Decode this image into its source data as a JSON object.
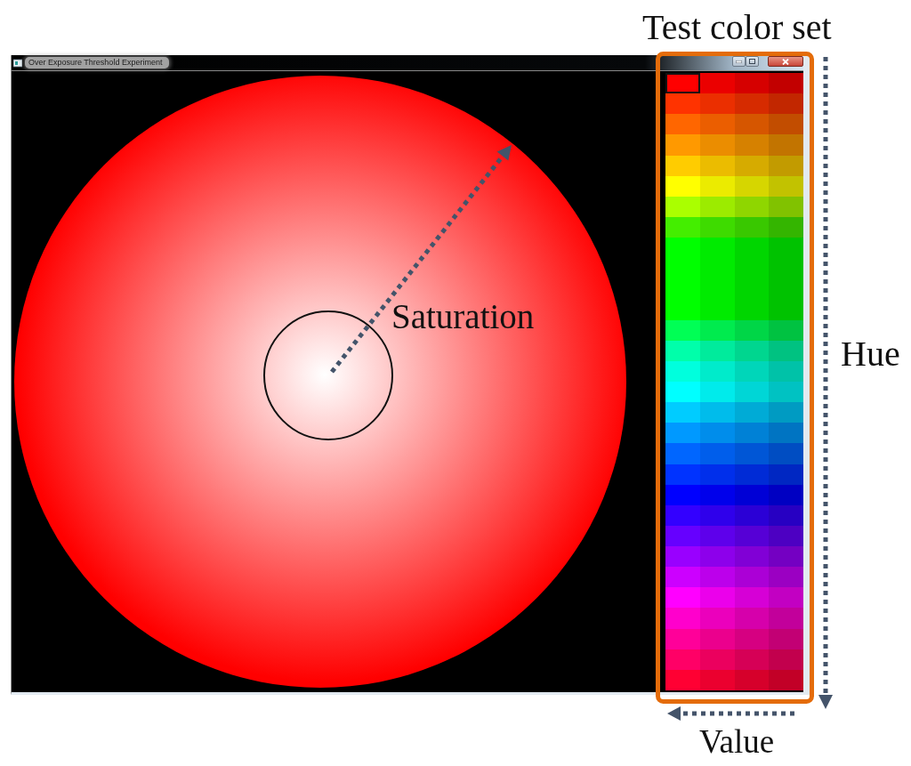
{
  "annotations": {
    "heading": "Test color set",
    "saturation_label": "Saturation",
    "hue_label": "Hue",
    "value_label": "Value"
  },
  "window": {
    "title": "Over Exposure Threshold Experiment"
  },
  "color_set": {
    "rows": [
      {
        "cells": [
          {
            "color": "#ff0000",
            "selected": true
          },
          {
            "color": "#eb0000",
            "selected": false
          },
          {
            "color": "#d60000",
            "selected": false
          },
          {
            "color": "#c20000",
            "selected": false
          }
        ]
      },
      {
        "cells": [
          {
            "color": "#ff3300",
            "selected": false
          },
          {
            "color": "#eb2f00",
            "selected": false
          },
          {
            "color": "#d62b00",
            "selected": false
          },
          {
            "color": "#c22700",
            "selected": false
          }
        ]
      },
      {
        "cells": [
          {
            "color": "#ff6600",
            "selected": false
          },
          {
            "color": "#eb5e00",
            "selected": false
          },
          {
            "color": "#d65600",
            "selected": false
          },
          {
            "color": "#c24d00",
            "selected": false
          }
        ]
      },
      {
        "cells": [
          {
            "color": "#ff9900",
            "selected": false
          },
          {
            "color": "#eb8d00",
            "selected": false
          },
          {
            "color": "#d68100",
            "selected": false
          },
          {
            "color": "#c27400",
            "selected": false
          }
        ]
      },
      {
        "cells": [
          {
            "color": "#ffcc00",
            "selected": false
          },
          {
            "color": "#ebbc00",
            "selected": false
          },
          {
            "color": "#d6ab00",
            "selected": false
          },
          {
            "color": "#c29b00",
            "selected": false
          }
        ]
      },
      {
        "cells": [
          {
            "color": "#ffff00",
            "selected": false
          },
          {
            "color": "#ebeb00",
            "selected": false
          },
          {
            "color": "#d6d600",
            "selected": false
          },
          {
            "color": "#c2c200",
            "selected": false
          }
        ]
      },
      {
        "cells": [
          {
            "color": "#aaff00",
            "selected": false
          },
          {
            "color": "#9ceb00",
            "selected": false
          },
          {
            "color": "#8fd600",
            "selected": false
          },
          {
            "color": "#81c200",
            "selected": false
          }
        ]
      },
      {
        "cells": [
          {
            "color": "#44ee00",
            "selected": false
          },
          {
            "color": "#3edb00",
            "selected": false
          },
          {
            "color": "#39c800",
            "selected": false
          },
          {
            "color": "#34b500",
            "selected": false
          }
        ]
      },
      {
        "cells": [
          {
            "color": "#00ff00",
            "selected": false
          },
          {
            "color": "#00eb00",
            "selected": false
          },
          {
            "color": "#00d600",
            "selected": false
          },
          {
            "color": "#00c200",
            "selected": false
          }
        ]
      },
      {
        "cells": [
          {
            "color": "#00ff00",
            "selected": false
          },
          {
            "color": "#00eb00",
            "selected": false
          },
          {
            "color": "#00d600",
            "selected": false
          },
          {
            "color": "#00c200",
            "selected": false
          }
        ]
      },
      {
        "cells": [
          {
            "color": "#00ff00",
            "selected": false
          },
          {
            "color": "#00eb00",
            "selected": false
          },
          {
            "color": "#00d600",
            "selected": false
          },
          {
            "color": "#00c200",
            "selected": false
          }
        ]
      },
      {
        "cells": [
          {
            "color": "#00ff00",
            "selected": false
          },
          {
            "color": "#00eb00",
            "selected": false
          },
          {
            "color": "#00d600",
            "selected": false
          },
          {
            "color": "#00c200",
            "selected": false
          }
        ]
      },
      {
        "cells": [
          {
            "color": "#00ff55",
            "selected": false
          },
          {
            "color": "#00eb4e",
            "selected": false
          },
          {
            "color": "#00d647",
            "selected": false
          },
          {
            "color": "#00c241",
            "selected": false
          }
        ]
      },
      {
        "cells": [
          {
            "color": "#00ffaa",
            "selected": false
          },
          {
            "color": "#00eb9c",
            "selected": false
          },
          {
            "color": "#00d68f",
            "selected": false
          },
          {
            "color": "#00c281",
            "selected": false
          }
        ]
      },
      {
        "cells": [
          {
            "color": "#00ffdd",
            "selected": false
          },
          {
            "color": "#00ebcb",
            "selected": false
          },
          {
            "color": "#00d6b9",
            "selected": false
          },
          {
            "color": "#00c2a8",
            "selected": false
          }
        ]
      },
      {
        "cells": [
          {
            "color": "#00ffff",
            "selected": false
          },
          {
            "color": "#00ebeb",
            "selected": false
          },
          {
            "color": "#00d6d6",
            "selected": false
          },
          {
            "color": "#00c2c2",
            "selected": false
          }
        ]
      },
      {
        "cells": [
          {
            "color": "#00ccff",
            "selected": false
          },
          {
            "color": "#00bceb",
            "selected": false
          },
          {
            "color": "#00abd6",
            "selected": false
          },
          {
            "color": "#009bc2",
            "selected": false
          }
        ]
      },
      {
        "cells": [
          {
            "color": "#0099ff",
            "selected": false
          },
          {
            "color": "#008deb",
            "selected": false
          },
          {
            "color": "#0081d6",
            "selected": false
          },
          {
            "color": "#0074c2",
            "selected": false
          }
        ]
      },
      {
        "cells": [
          {
            "color": "#0066ff",
            "selected": false
          },
          {
            "color": "#005eeb",
            "selected": false
          },
          {
            "color": "#0056d6",
            "selected": false
          },
          {
            "color": "#004dc2",
            "selected": false
          }
        ]
      },
      {
        "cells": [
          {
            "color": "#0033ff",
            "selected": false
          },
          {
            "color": "#002feb",
            "selected": false
          },
          {
            "color": "#002bd6",
            "selected": false
          },
          {
            "color": "#0027c2",
            "selected": false
          }
        ]
      },
      {
        "cells": [
          {
            "color": "#0000ff",
            "selected": false
          },
          {
            "color": "#0000eb",
            "selected": false
          },
          {
            "color": "#0000d6",
            "selected": false
          },
          {
            "color": "#0000c2",
            "selected": false
          }
        ]
      },
      {
        "cells": [
          {
            "color": "#3300ff",
            "selected": false
          },
          {
            "color": "#2f00eb",
            "selected": false
          },
          {
            "color": "#2b00d6",
            "selected": false
          },
          {
            "color": "#2700c2",
            "selected": false
          }
        ]
      },
      {
        "cells": [
          {
            "color": "#6600ff",
            "selected": false
          },
          {
            "color": "#5e00eb",
            "selected": false
          },
          {
            "color": "#5600d6",
            "selected": false
          },
          {
            "color": "#4d00c2",
            "selected": false
          }
        ]
      },
      {
        "cells": [
          {
            "color": "#9900ff",
            "selected": false
          },
          {
            "color": "#8d00eb",
            "selected": false
          },
          {
            "color": "#8100d6",
            "selected": false
          },
          {
            "color": "#7400c2",
            "selected": false
          }
        ]
      },
      {
        "cells": [
          {
            "color": "#cc00ff",
            "selected": false
          },
          {
            "color": "#bc00eb",
            "selected": false
          },
          {
            "color": "#ab00d6",
            "selected": false
          },
          {
            "color": "#9b00c2",
            "selected": false
          }
        ]
      },
      {
        "cells": [
          {
            "color": "#ff00ff",
            "selected": false
          },
          {
            "color": "#eb00eb",
            "selected": false
          },
          {
            "color": "#d600d6",
            "selected": false
          },
          {
            "color": "#c200c2",
            "selected": false
          }
        ]
      },
      {
        "cells": [
          {
            "color": "#ff00cc",
            "selected": false
          },
          {
            "color": "#eb00bc",
            "selected": false
          },
          {
            "color": "#d600ab",
            "selected": false
          },
          {
            "color": "#c2009b",
            "selected": false
          }
        ]
      },
      {
        "cells": [
          {
            "color": "#ff0099",
            "selected": false
          },
          {
            "color": "#eb008d",
            "selected": false
          },
          {
            "color": "#d60081",
            "selected": false
          },
          {
            "color": "#c20074",
            "selected": false
          }
        ]
      },
      {
        "cells": [
          {
            "color": "#ff0066",
            "selected": false
          },
          {
            "color": "#eb005e",
            "selected": false
          },
          {
            "color": "#d60056",
            "selected": false
          },
          {
            "color": "#c2004d",
            "selected": false
          }
        ]
      },
      {
        "cells": [
          {
            "color": "#ff0033",
            "selected": false
          },
          {
            "color": "#eb002f",
            "selected": false
          },
          {
            "color": "#d6002b",
            "selected": false
          },
          {
            "color": "#c20027",
            "selected": false
          }
        ]
      }
    ]
  }
}
